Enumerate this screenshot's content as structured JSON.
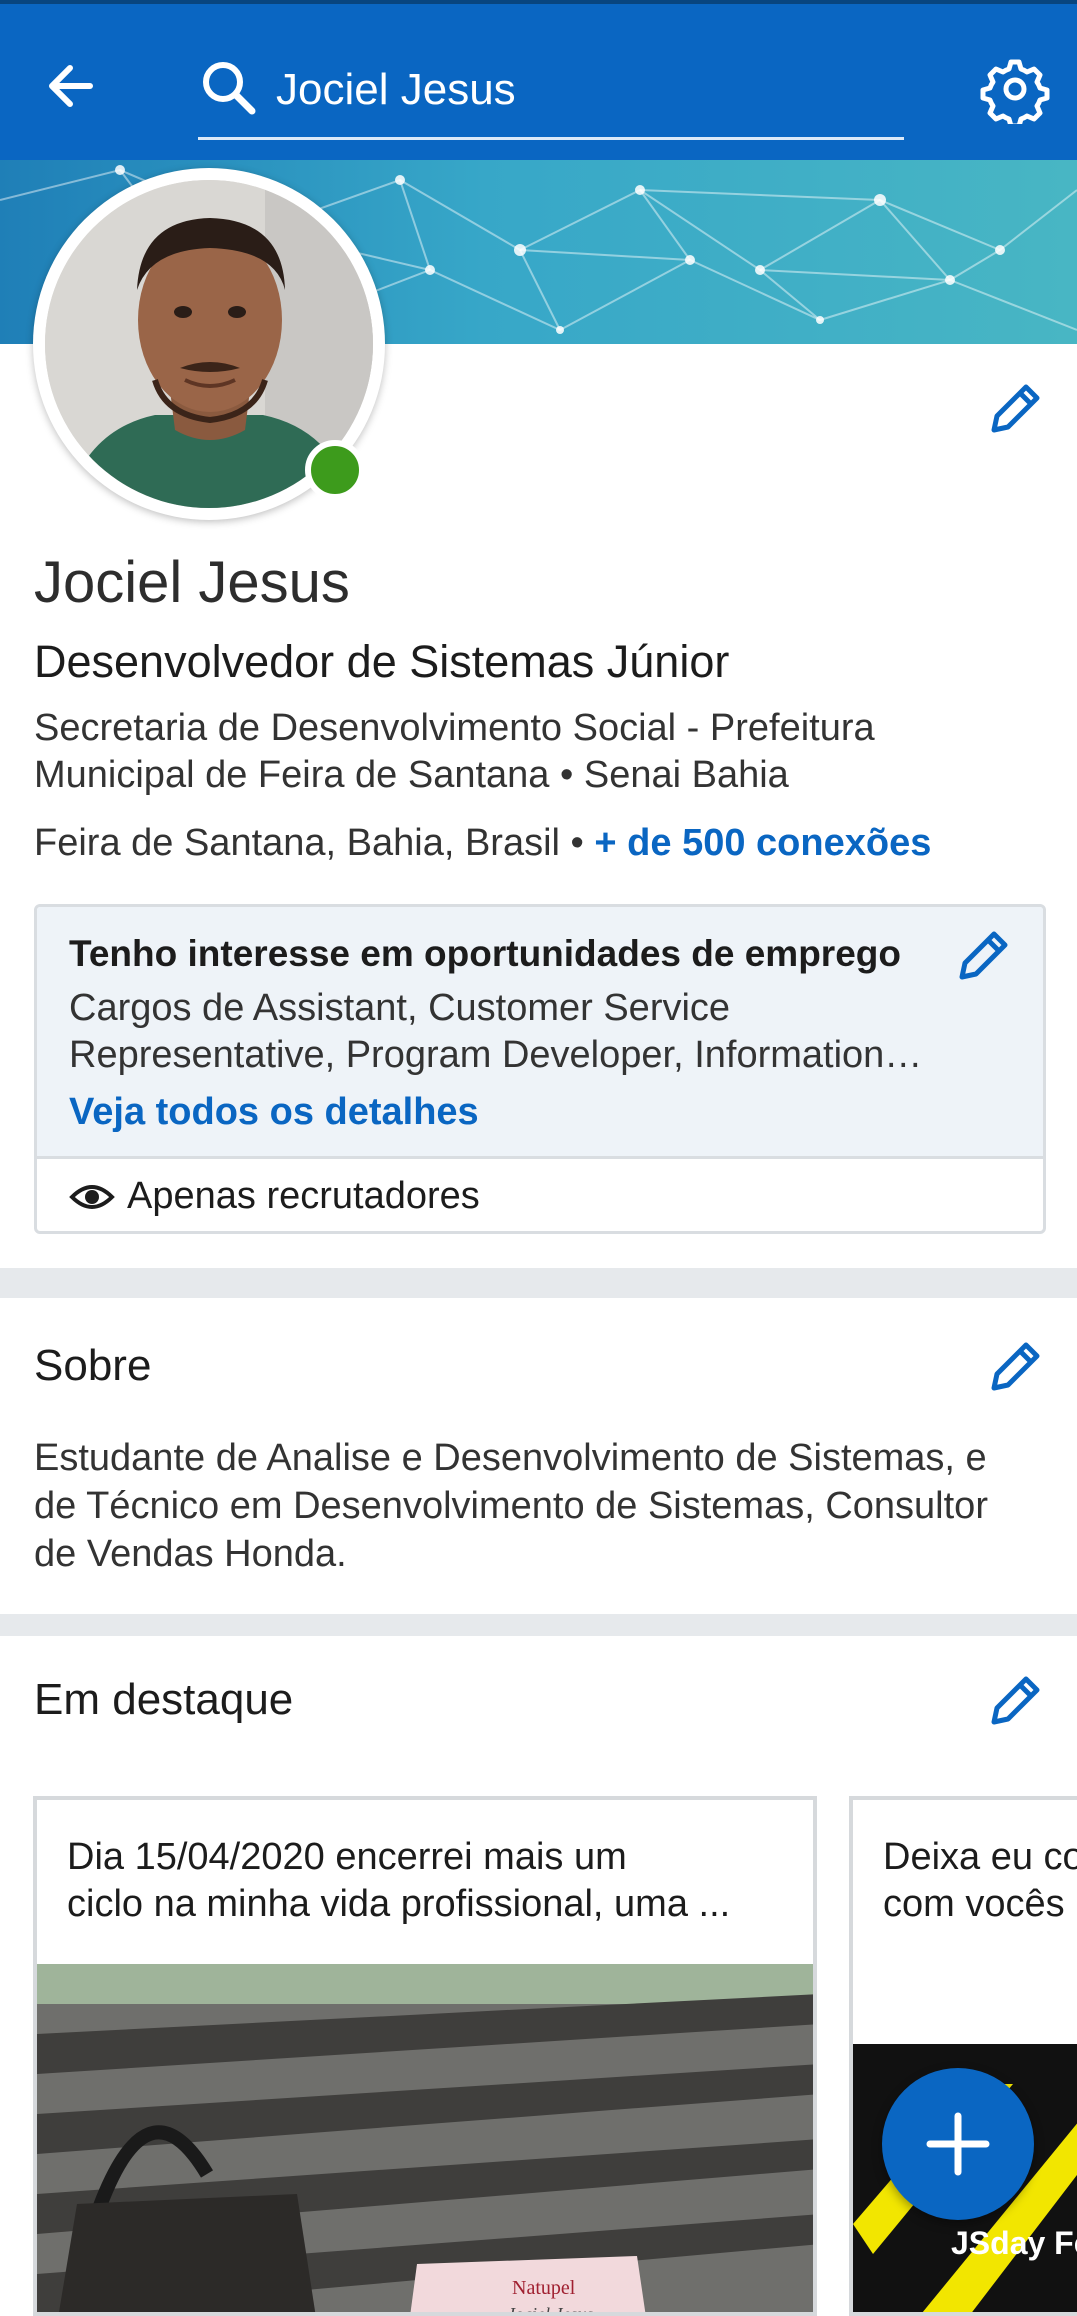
{
  "header": {
    "search_value": "Jociel Jesus",
    "colors": {
      "bar": "#0a66c2",
      "text": "#ffffff"
    }
  },
  "profile": {
    "name": "Jociel Jesus",
    "headline": "Desenvolvedor de Sistemas Júnior",
    "company_line1": "Secretaria de Desenvolvimento Social - Prefeitura",
    "company_line2": "Municipal de Feira de Santana • Senai Bahia",
    "location": "Feira de Santana, Bahia, Brasil",
    "separator": "•",
    "connections": "+ de 500 conexões",
    "online_status_color": "#3d9b1c"
  },
  "open_to_work": {
    "title": "Tenho interesse em oportunidades de emprego",
    "desc_line1": "Cargos de Assistant, Customer Service",
    "desc_line2": "Representative, Program Developer, Information…",
    "link": "Veja todos os detalhes",
    "visibility": "Apenas recrutadores"
  },
  "about": {
    "title": "Sobre",
    "text_line1": "Estudante de  Analise e Desenvolvimento de Sistemas,  e",
    "text_line2": "de Técnico em Desenvolvimento de Sistemas, Consultor",
    "text_line3": "de Vendas Honda."
  },
  "featured": {
    "title": "Em destaque",
    "items": [
      {
        "line1": "Dia 15/04/2020 encerrei mais um",
        "line2": "ciclo na minha vida profissional, uma ...",
        "image_label_brand": "Natupel",
        "image_label_name": "Jociel Jesus"
      },
      {
        "line1": "Deixa eu co",
        "line2": "com vocês",
        "image_label": "JSday Fe"
      }
    ]
  },
  "icons": [
    "back-arrow-icon",
    "search-icon",
    "gear-icon",
    "pencil-icon",
    "eye-icon",
    "plus-icon"
  ]
}
